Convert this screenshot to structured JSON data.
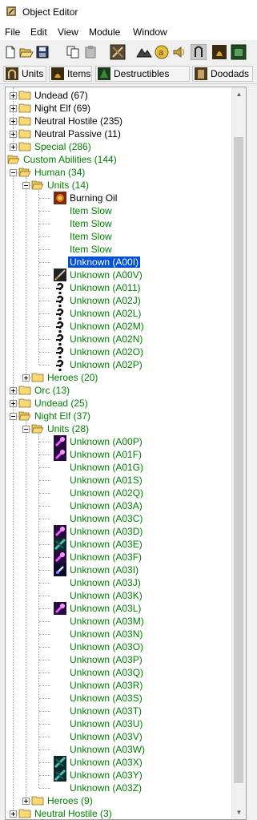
{
  "window": {
    "title": "Object Editor"
  },
  "menu": [
    "File",
    "Edit",
    "View",
    "Module",
    "Window"
  ],
  "toolbar_icons": [
    "new-icon",
    "open-icon",
    "save-icon",
    "copy-icon",
    "paste-icon",
    "unit-editor-icon",
    "terrain-icon",
    "gold-icon",
    "sound-icon",
    "ability-icon",
    "item-icon",
    "doodad-icon"
  ],
  "tabs": [
    {
      "label": "Units",
      "icon": "units-icon"
    },
    {
      "label": "Items",
      "icon": "items-icon"
    },
    {
      "label": "Destructibles",
      "icon": "destructibles-icon"
    },
    {
      "label": "Doodads",
      "icon": "doodads-icon"
    }
  ],
  "tree": [
    {
      "label": "Undead (67)",
      "depth": 0,
      "kind": "folder",
      "toggle": "+"
    },
    {
      "label": "Night Elf (69)",
      "depth": 0,
      "kind": "folder",
      "toggle": "+"
    },
    {
      "label": "Neutral Hostile (235)",
      "depth": 0,
      "kind": "folder",
      "toggle": "+"
    },
    {
      "label": "Neutral Passive (11)",
      "depth": 0,
      "kind": "folder",
      "toggle": "+"
    },
    {
      "label": "Special (286)",
      "depth": 0,
      "kind": "folder",
      "toggle": "+",
      "green": true
    },
    {
      "label": "Custom Abilities (144)",
      "depth": -1,
      "kind": "open-folder",
      "toggle": "",
      "green": true
    },
    {
      "label": "Human (34)",
      "depth": 0,
      "kind": "open-folder",
      "toggle": "-",
      "green": true
    },
    {
      "label": "Units (14)",
      "depth": 1,
      "kind": "open-folder",
      "toggle": "-",
      "green": true
    },
    {
      "label": "Burning Oil",
      "depth": 2,
      "kind": "item",
      "icon": "burning-oil-icon"
    },
    {
      "label": "Item Slow",
      "depth": 2,
      "kind": "item",
      "icon": "",
      "green": true
    },
    {
      "label": "Item Slow",
      "depth": 2,
      "kind": "item",
      "icon": "",
      "green": true
    },
    {
      "label": "Item Slow",
      "depth": 2,
      "kind": "item",
      "icon": "",
      "green": true
    },
    {
      "label": "Item Slow",
      "depth": 2,
      "kind": "item",
      "icon": "",
      "green": true
    },
    {
      "label": "Unknown (A00I)",
      "depth": 2,
      "kind": "item",
      "icon": "",
      "selected": true
    },
    {
      "label": "Unknown (A00V)",
      "depth": 2,
      "kind": "item",
      "icon": "sword-ability-icon",
      "green": true
    },
    {
      "label": "Unknown (A011)",
      "depth": 2,
      "kind": "item",
      "icon": "unknown-ability-icon",
      "green": true
    },
    {
      "label": "Unknown (A02J)",
      "depth": 2,
      "kind": "item",
      "icon": "unknown-ability-icon",
      "green": true
    },
    {
      "label": "Unknown (A02L)",
      "depth": 2,
      "kind": "item",
      "icon": "unknown-ability-icon",
      "green": true
    },
    {
      "label": "Unknown (A02M)",
      "depth": 2,
      "kind": "item",
      "icon": "unknown-ability-icon",
      "green": true
    },
    {
      "label": "Unknown (A02N)",
      "depth": 2,
      "kind": "item",
      "icon": "unknown-ability-icon",
      "green": true
    },
    {
      "label": "Unknown (A02O)",
      "depth": 2,
      "kind": "item",
      "icon": "unknown-ability-icon",
      "green": true
    },
    {
      "label": "Unknown (A02P)",
      "depth": 2,
      "kind": "item",
      "icon": "unknown-ability-icon",
      "green": true
    },
    {
      "label": "Heroes (20)",
      "depth": 1,
      "kind": "folder",
      "toggle": "+",
      "green": true
    },
    {
      "label": "Orc (13)",
      "depth": 0,
      "kind": "folder",
      "toggle": "+",
      "green": true
    },
    {
      "label": "Undead (25)",
      "depth": 0,
      "kind": "folder",
      "toggle": "+",
      "green": true
    },
    {
      "label": "Night Elf (37)",
      "depth": 0,
      "kind": "open-folder",
      "toggle": "-",
      "green": true
    },
    {
      "label": "Units (28)",
      "depth": 1,
      "kind": "open-folder",
      "toggle": "-",
      "green": true
    },
    {
      "label": "Unknown (A00P)",
      "depth": 2,
      "kind": "item",
      "icon": "purple-spell-icon",
      "green": true
    },
    {
      "label": "Unknown (A01F)",
      "depth": 2,
      "kind": "item",
      "icon": "purple-spell-icon",
      "green": true
    },
    {
      "label": "Unknown (A01G)",
      "depth": 2,
      "kind": "item",
      "icon": "",
      "green": true
    },
    {
      "label": "Unknown (A01S)",
      "depth": 2,
      "kind": "item",
      "icon": "",
      "green": true
    },
    {
      "label": "Unknown (A02Q)",
      "depth": 2,
      "kind": "item",
      "icon": "",
      "green": true
    },
    {
      "label": "Unknown (A03A)",
      "depth": 2,
      "kind": "item",
      "icon": "",
      "green": true
    },
    {
      "label": "Unknown (A03C)",
      "depth": 2,
      "kind": "item",
      "icon": "",
      "green": true
    },
    {
      "label": "Unknown (A03D)",
      "depth": 2,
      "kind": "item",
      "icon": "purple-spell-icon",
      "green": true
    },
    {
      "label": "Unknown (A03E)",
      "depth": 2,
      "kind": "item",
      "icon": "teal-spell-icon",
      "green": true
    },
    {
      "label": "Unknown (A03F)",
      "depth": 2,
      "kind": "item",
      "icon": "purple-spell-icon",
      "green": true
    },
    {
      "label": "Unknown (A03I)",
      "depth": 2,
      "kind": "item",
      "icon": "dark-spell-icon",
      "green": true
    },
    {
      "label": "Unknown (A03J)",
      "depth": 2,
      "kind": "item",
      "icon": "",
      "green": true
    },
    {
      "label": "Unknown (A03K)",
      "depth": 2,
      "kind": "item",
      "icon": "",
      "green": true
    },
    {
      "label": "Unknown (A03L)",
      "depth": 2,
      "kind": "item",
      "icon": "purple-spell-icon",
      "green": true
    },
    {
      "label": "Unknown (A03M)",
      "depth": 2,
      "kind": "item",
      "icon": "",
      "green": true
    },
    {
      "label": "Unknown (A03N)",
      "depth": 2,
      "kind": "item",
      "icon": "",
      "green": true
    },
    {
      "label": "Unknown (A03O)",
      "depth": 2,
      "kind": "item",
      "icon": "",
      "green": true
    },
    {
      "label": "Unknown (A03P)",
      "depth": 2,
      "kind": "item",
      "icon": "",
      "green": true
    },
    {
      "label": "Unknown (A03Q)",
      "depth": 2,
      "kind": "item",
      "icon": "",
      "green": true
    },
    {
      "label": "Unknown (A03R)",
      "depth": 2,
      "kind": "item",
      "icon": "",
      "green": true
    },
    {
      "label": "Unknown (A03S)",
      "depth": 2,
      "kind": "item",
      "icon": "",
      "green": true
    },
    {
      "label": "Unknown (A03T)",
      "depth": 2,
      "kind": "item",
      "icon": "",
      "green": true
    },
    {
      "label": "Unknown (A03U)",
      "depth": 2,
      "kind": "item",
      "icon": "",
      "green": true
    },
    {
      "label": "Unknown (A03V)",
      "depth": 2,
      "kind": "item",
      "icon": "",
      "green": true
    },
    {
      "label": "Unknown (A03W)",
      "depth": 2,
      "kind": "item",
      "icon": "",
      "green": true
    },
    {
      "label": "Unknown (A03X)",
      "depth": 2,
      "kind": "item",
      "icon": "teal-spell-icon",
      "green": true
    },
    {
      "label": "Unknown (A03Y)",
      "depth": 2,
      "kind": "item",
      "icon": "teal-spell-icon",
      "green": true
    },
    {
      "label": "Unknown (A03Z)",
      "depth": 2,
      "kind": "item",
      "icon": "",
      "green": true
    },
    {
      "label": "Heroes (9)",
      "depth": 1,
      "kind": "folder",
      "toggle": "+",
      "green": true
    },
    {
      "label": "Neutral Hostile (3)",
      "depth": 0,
      "kind": "folder",
      "toggle": "+",
      "green": true
    }
  ],
  "colors": {
    "green_text": "#008000",
    "selection": "#0050d8",
    "folder": "#f8d775"
  }
}
